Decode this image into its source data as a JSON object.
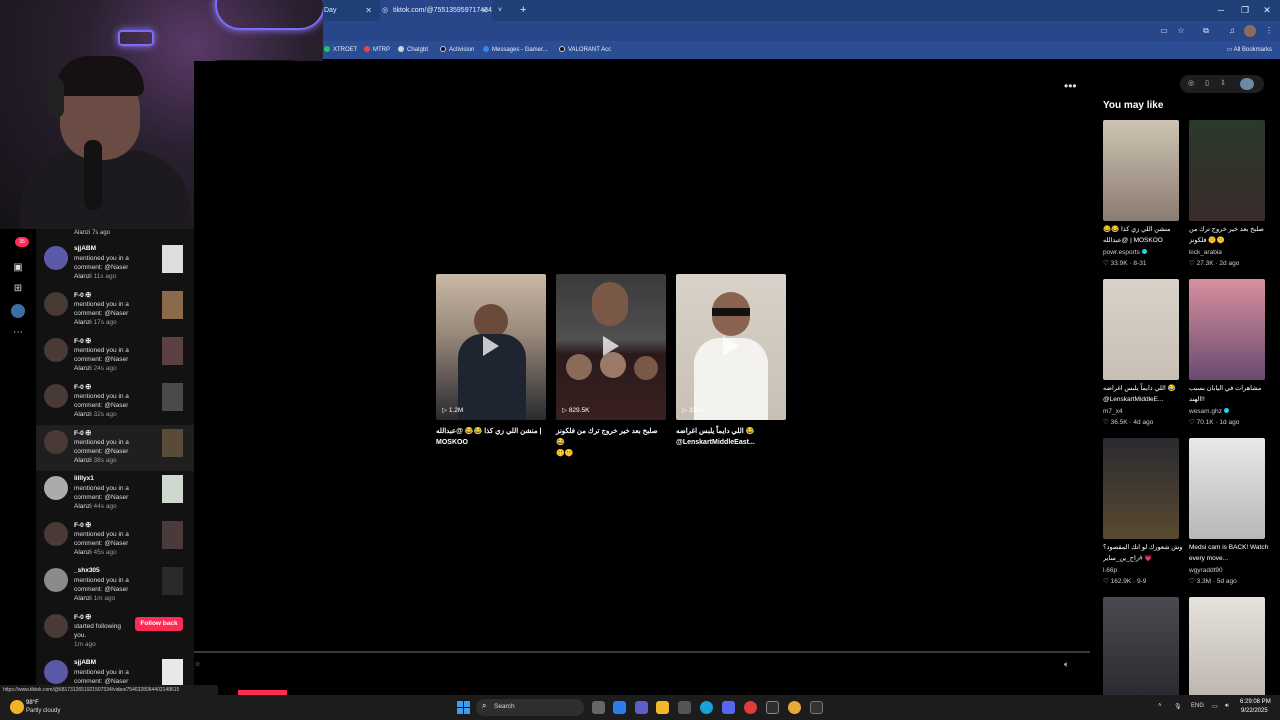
{
  "browser": {
    "tabs": [
      {
        "label": "Day"
      },
      {
        "label": "tiktok.com/@755135959717434"
      },
      {
        "label": ""
      }
    ],
    "new_tab": "+",
    "bookmarks": [
      {
        "label": "XTROET",
        "color": "#22c55e"
      },
      {
        "label": "MTRP",
        "color": "#ef4444"
      },
      {
        "label": "Chatgbt",
        "color": "#d1d5db"
      },
      {
        "label": "Activision",
        "color": "#111111"
      },
      {
        "label": "Messages - Gamer...",
        "color": "#3b82f6"
      },
      {
        "label": "VALORANT Acc",
        "color": "#111111"
      }
    ],
    "all_bookmarks": "All Bookmarks"
  },
  "notifications": {
    "tail_text": "Alanzi 7s ago",
    "items": [
      {
        "name": "sjjABM",
        "line1": "mentioned you in a",
        "line2": "comment: @Naser",
        "line3": "Alanzi",
        "time": "11s ago"
      },
      {
        "name": "F-0 ✠",
        "line1": "mentioned you in a",
        "line2": "comment: @Naser",
        "line3": "Alanzi",
        "time": "17s ago"
      },
      {
        "name": "F-0 ✠",
        "line1": "mentioned you in a",
        "line2": "comment: @Naser",
        "line3": "Alanzi",
        "time": "24s ago"
      },
      {
        "name": "F-0 ✠",
        "line1": "mentioned you in a",
        "line2": "comment: @Naser",
        "line3": "Alanzi",
        "time": "32s ago"
      },
      {
        "name": "F-0 ✠",
        "line1": "mentioned you in a",
        "line2": "comment: @Naser",
        "line3": "Alanzi",
        "time": "38s ago"
      },
      {
        "name": "lilllyx1",
        "line1": "mentioned you in a",
        "line2": "comment: @Naser",
        "line3": "Alanzi",
        "time": "44s ago"
      },
      {
        "name": "F-0 ✠",
        "line1": "mentioned you in a",
        "line2": "comment: @Naser",
        "line3": "Alanzi",
        "time": "45s ago"
      },
      {
        "name": "_shx305",
        "line1": "mentioned you in a",
        "line2": "comment: @Naser",
        "line3": "Alanzi",
        "time": "1m ago"
      },
      {
        "name": "F-0 ✠",
        "line1": "started following",
        "line2": "you.",
        "line3": "",
        "time": "1m ago"
      },
      {
        "name": "sjjABM",
        "line1": "mentioned you in a",
        "line2": "comment: @Naser",
        "line3": "Alanzi",
        "time": "1m ago"
      }
    ],
    "follow_back": "Follow back",
    "badge_count": "35"
  },
  "player": {
    "cards": [
      {
        "views": "1.2M",
        "caption1": "منشن اللي زي كذا 😂😂 @عبدالله |",
        "caption2": "MOSKOO"
      },
      {
        "views": "829.5K",
        "caption1": "صلبخ بعد خير خروج ترك من فلكونز 😂",
        "caption2": "🤫🤫"
      },
      {
        "views": "338K",
        "caption1": "اللي دايماً يلبس اغراضه 😂",
        "caption2": "@LenskartMiddleEast..."
      }
    ],
    "time": "0:"
  },
  "side": {
    "title": "You may like",
    "recs": [
      {
        "caption": "منشن اللي زي كذا 😂😂 @عبدالله | MOSKOO",
        "author": "powr.esports",
        "verified": true,
        "likes": "33.9K",
        "date": "8-31"
      },
      {
        "caption": "صلبخ بعد خير خروج ترك من فلكونز 🤫🤫",
        "author": "kick_arabia",
        "verified": false,
        "likes": "27.3K",
        "date": "2d ago"
      },
      {
        "caption": "اللي دايماً يلبس اغراضه 😂 @LenskartMiddleE...",
        "author": "m7_x4",
        "verified": false,
        "likes": "36.5K",
        "date": "4d ago"
      },
      {
        "caption": "مشاهرات في اليابان بسبب الهند!!",
        "author": "wesam.ghz",
        "verified": true,
        "likes": "70.1K",
        "date": "1d ago"
      },
      {
        "caption": "وش شعورك لو انك المقصود؟ #راح_ين_ساير 💗",
        "author": "l.66p",
        "verified": false,
        "likes": "162.9K",
        "date": "9-9"
      },
      {
        "caption": "Medsi cam is BACK! Watch every move...",
        "author": "wgyraddt90",
        "verified": false,
        "likes": "3.3M",
        "date": "5d ago"
      },
      {
        "caption": "",
        "author": "",
        "verified": false,
        "likes": "",
        "date": ""
      },
      {
        "caption": "",
        "author": "",
        "verified": false,
        "likes": "",
        "date": ""
      }
    ]
  },
  "status_url": "https://www.tiktok.com/@6817312651921507334/video/7546328064402148615",
  "taskbar": {
    "temp": "98°F",
    "weather": "Partly cloudy",
    "search": "Search",
    "lang": "ENG",
    "time": "6:29:08 PM",
    "date": "9/22/2025"
  }
}
